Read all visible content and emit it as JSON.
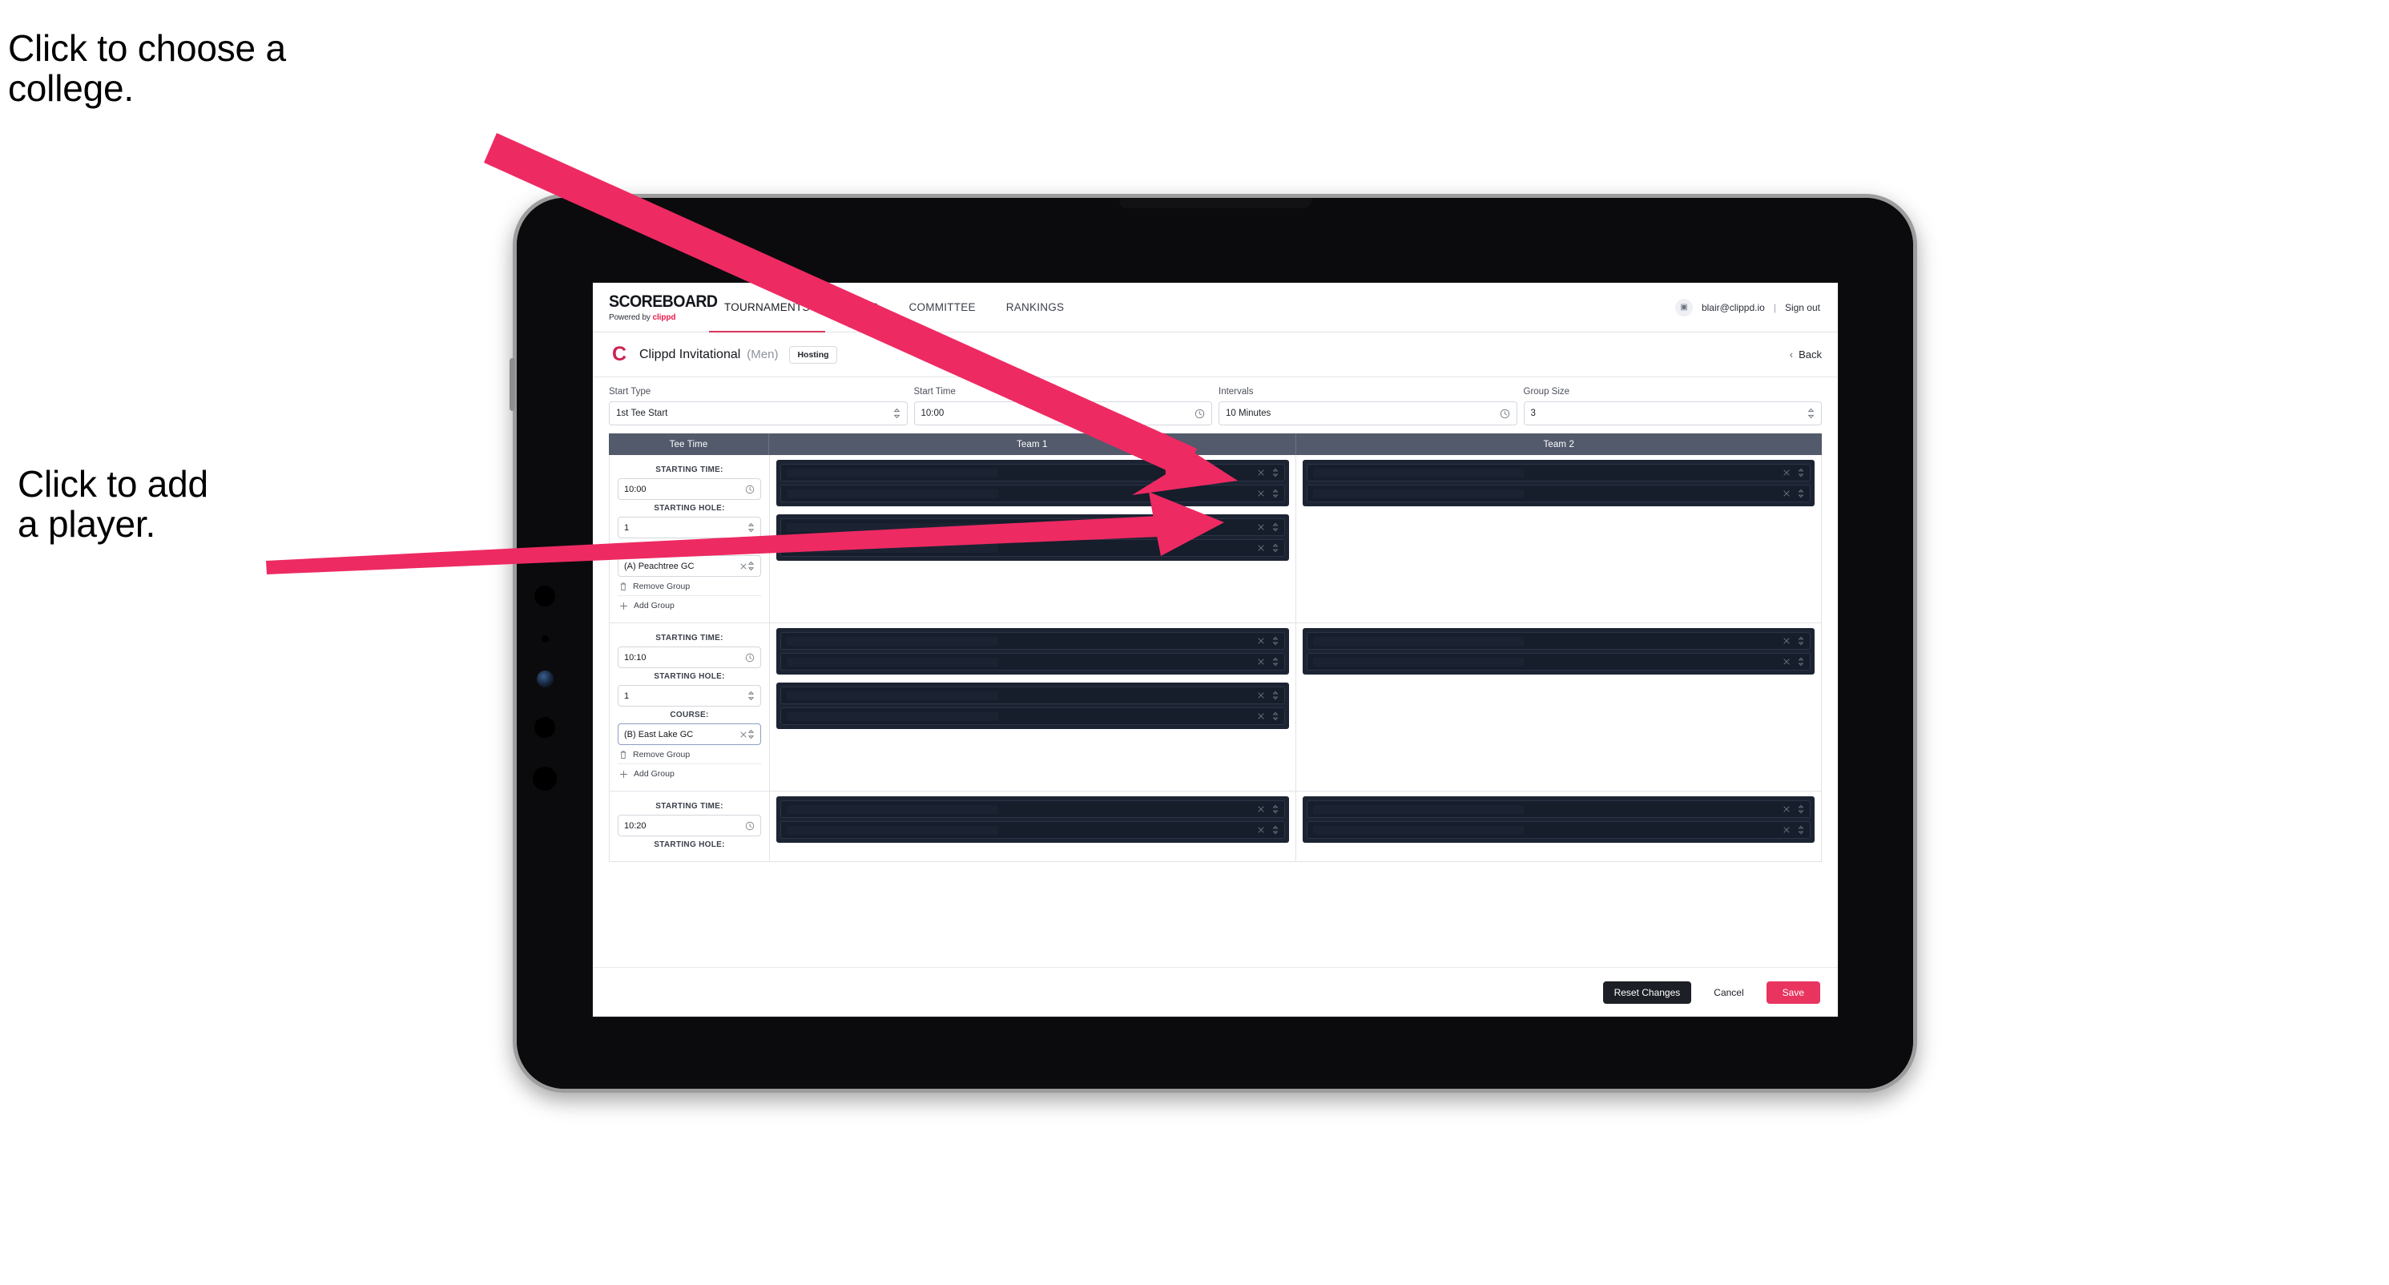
{
  "annotations": {
    "college": "Click to choose a\ncollege.",
    "player": "Click to add\na player.",
    "arrow_color": "#EE2A63"
  },
  "app": {
    "brand": {
      "title": "SCOREBOARD",
      "powered_prefix": "Powered by ",
      "powered_brand": "clippd"
    },
    "nav": [
      {
        "label": "TOURNAMENTS",
        "active": true
      },
      {
        "label": "TEAMS",
        "active": false
      },
      {
        "label": "COMMITTEE",
        "active": false
      },
      {
        "label": "RANKINGS",
        "active": false
      }
    ],
    "account": {
      "avatar_glyph": "▣",
      "email": "blair@clippd.io",
      "separator": "|",
      "sign_out": "Sign out"
    }
  },
  "titlebar": {
    "logo_glyph": "C",
    "tournament": "Clippd Invitational",
    "gender": "(Men)",
    "badge": "Hosting",
    "back_chevron": "‹",
    "back_label": "Back"
  },
  "controls": [
    {
      "label": "Start Type",
      "value": "1st Tee Start",
      "icon": "stepper-icon"
    },
    {
      "label": "Start Time",
      "value": "10:00",
      "icon": "clock-icon"
    },
    {
      "label": "Intervals",
      "value": "10 Minutes",
      "icon": "clock-icon"
    },
    {
      "label": "Group Size",
      "value": "3",
      "icon": "stepper-icon"
    }
  ],
  "table": {
    "headers": {
      "tee_time": "Tee Time",
      "team1": "Team 1",
      "team2": "Team 2"
    },
    "field_labels": {
      "starting_time": "STARTING TIME:",
      "starting_hole": "STARTING HOLE:",
      "course": "COURSE:"
    },
    "group_actions": {
      "remove": "Remove Group",
      "add": "Add Group"
    },
    "groups": [
      {
        "starting_time": "10:00",
        "starting_hole": "1",
        "course": "(A) Peachtree GC",
        "course_focused": false,
        "team1": [
          {
            "slots": 2
          },
          {
            "slots": 2
          }
        ],
        "team2": [
          {
            "slots": 2
          }
        ]
      },
      {
        "starting_time": "10:10",
        "starting_hole": "1",
        "course": "(B) East Lake GC",
        "course_focused": true,
        "team1": [
          {
            "slots": 2
          },
          {
            "slots": 2
          }
        ],
        "team2": [
          {
            "slots": 2
          }
        ]
      },
      {
        "starting_time": "10:20",
        "starting_hole": "",
        "course": "",
        "course_focused": false,
        "team1": [
          {
            "slots": 2
          }
        ],
        "team2": [
          {
            "slots": 2
          }
        ]
      }
    ]
  },
  "footer": {
    "reset": "Reset Changes",
    "cancel": "Cancel",
    "save": "Save"
  },
  "colors": {
    "accent_pink": "#E8345F",
    "header_slate": "#525A6B",
    "slot_dark": "#1C2433",
    "brand_red": "#D6365C"
  }
}
